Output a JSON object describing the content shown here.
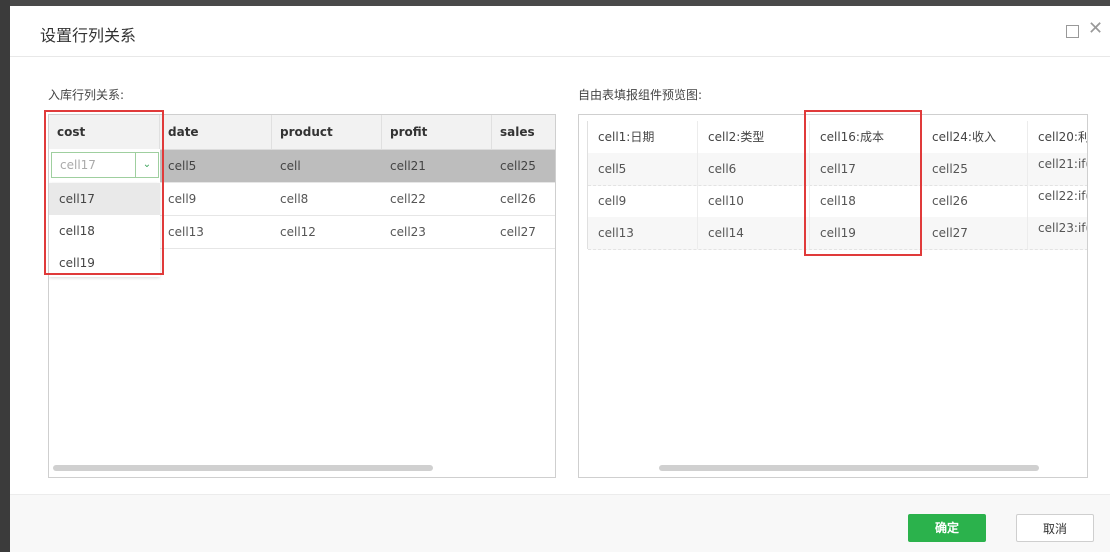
{
  "dialog": {
    "title": "设置行列关系",
    "ok_label": "确定",
    "cancel_label": "取消"
  },
  "left": {
    "label": "入库行列关系:",
    "headers": [
      "cost",
      "date",
      "product",
      "profit",
      "sales"
    ],
    "combo_value": "cell17",
    "rows": [
      [
        "cell5",
        "cell",
        "cell21",
        "cell25"
      ],
      [
        "cell9",
        "cell8",
        "cell22",
        "cell26"
      ],
      [
        "cell13",
        "cell12",
        "cell23",
        "cell27"
      ]
    ],
    "dropdown_options": [
      "cell17",
      "cell18",
      "cell19"
    ]
  },
  "right": {
    "label": "自由表填报组件预览图:",
    "rows": [
      [
        "cell1:日期",
        "cell2:类型",
        "cell16:成本",
        "cell24:收入",
        "cell20:利"
      ],
      [
        "cell5",
        "cell6",
        "cell17",
        "cell25",
        "cell21:if("
      ],
      [
        "cell9",
        "cell10",
        "cell18",
        "cell26",
        "cell22:if("
      ],
      [
        "cell13",
        "cell14",
        "cell19",
        "cell27",
        "cell23:if("
      ]
    ]
  },
  "colors": {
    "accent": "#2bb24c",
    "highlight": "#e03a3a",
    "selected_row": "#bdbdbd"
  }
}
